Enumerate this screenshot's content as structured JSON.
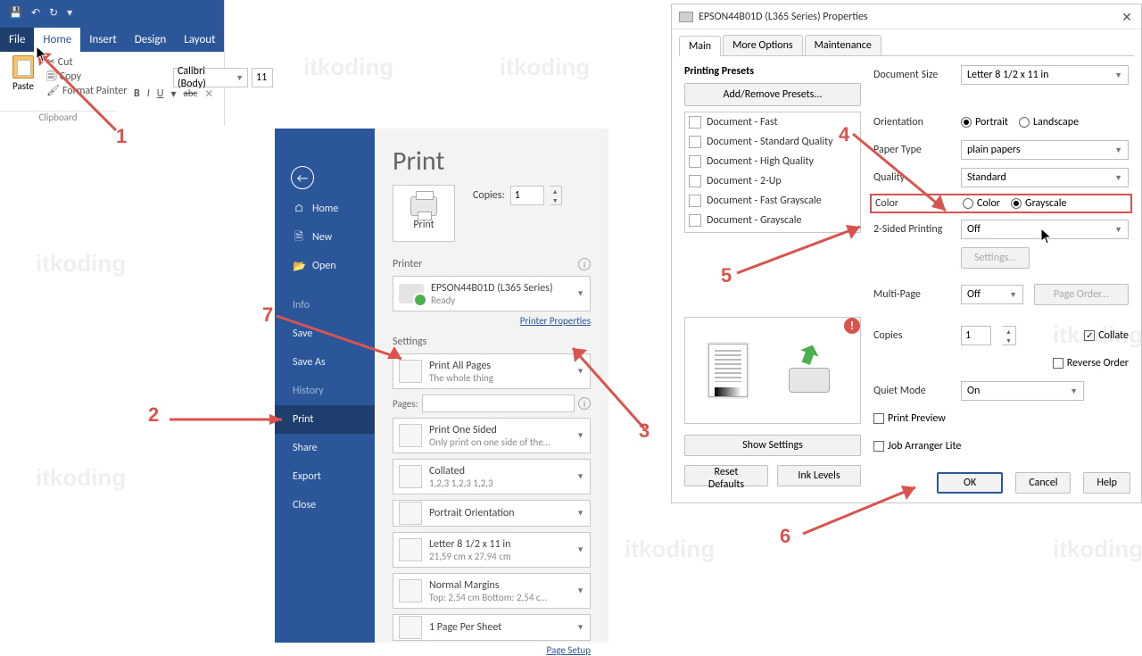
{
  "word": {
    "qat": {
      "save": "💾",
      "undo": "↶",
      "redo": "↻",
      "more": "▾"
    },
    "tabs": [
      "File",
      "Home",
      "Insert",
      "Design",
      "Layout"
    ],
    "paste_label": "Paste",
    "cut": "Cut",
    "copy": "Copy",
    "format_painter": "Format Painter",
    "clipboard_group": "Clipboard",
    "font_name": "Calibri (Body)",
    "font_size": "11",
    "b": "B",
    "i": "I",
    "u": "U",
    "strike": "abc",
    "x": "✕"
  },
  "backstage": {
    "items": [
      {
        "icon": "⌂",
        "label": "Home"
      },
      {
        "icon": "🗎",
        "label": "New"
      },
      {
        "icon": "📂",
        "label": "Open"
      },
      {
        "icon": "",
        "label": "Info",
        "dim": true
      },
      {
        "icon": "",
        "label": "Save"
      },
      {
        "icon": "",
        "label": "Save As"
      },
      {
        "icon": "",
        "label": "History",
        "dim": true
      },
      {
        "icon": "",
        "label": "Print",
        "active": true
      },
      {
        "icon": "",
        "label": "Share"
      },
      {
        "icon": "",
        "label": "Export"
      },
      {
        "icon": "",
        "label": "Close"
      }
    ],
    "title": "Print",
    "print_button": "Print",
    "copies_label": "Copies:",
    "copies_value": "1",
    "printer_header": "Printer",
    "printer_name": "EPSON44B01D (L365 Series)",
    "printer_status": "Ready",
    "printer_properties": "Printer Properties",
    "settings_header": "Settings",
    "pages_label": "Pages:",
    "page_setup": "Page Setup",
    "settings": [
      {
        "t1": "Print All Pages",
        "t2": "The whole thing"
      },
      {
        "t1": "Print One Sided",
        "t2": "Only print on one side of the…"
      },
      {
        "t1": "Collated",
        "t2": "1,2,3    1,2,3    1,2,3"
      },
      {
        "t1": "Portrait Orientation",
        "t2": ""
      },
      {
        "t1": "Letter 8 1/2 x 11 in",
        "t2": "21,59 cm x 27,94 cm"
      },
      {
        "t1": "Normal Margins",
        "t2": "Top: 2,54 cm Bottom: 2,54 c…"
      },
      {
        "t1": "1 Page Per Sheet",
        "t2": ""
      }
    ]
  },
  "dlg": {
    "title": "EPSON44B01D (L365 Series) Properties",
    "tabs": [
      "Main",
      "More Options",
      "Maintenance"
    ],
    "presets_title": "Printing Presets",
    "add_remove": "Add/Remove Presets...",
    "preset_items": [
      "Document - Fast",
      "Document - Standard Quality",
      "Document - High Quality",
      "Document - 2-Up",
      "Document - Fast Grayscale",
      "Document - Grayscale"
    ],
    "show_settings": "Show Settings",
    "reset_defaults": "Reset Defaults",
    "ink_levels": "Ink Levels",
    "labels": {
      "doc_size": "Document Size",
      "orientation": "Orientation",
      "paper_type": "Paper Type",
      "quality": "Quality",
      "color": "Color",
      "two_sided": "2-Sided Printing",
      "multi_page": "Multi-Page",
      "copies": "Copies",
      "quiet": "Quiet Mode"
    },
    "doc_size": "Letter 8 1/2 x 11 in",
    "orientation": {
      "portrait": "Portrait",
      "landscape": "Landscape",
      "value": "Portrait"
    },
    "paper_type": "plain papers",
    "quality": "Standard",
    "color": {
      "color": "Color",
      "grayscale": "Grayscale",
      "value": "Grayscale"
    },
    "two_sided": "Off",
    "settings_btn": "Settings...",
    "multi_page": "Off",
    "page_order": "Page Order...",
    "copies_value": "1",
    "collate": "Collate",
    "reverse": "Reverse Order",
    "quiet": "On",
    "print_preview": "Print Preview",
    "job_arranger": "Job Arranger Lite",
    "ok": "OK",
    "cancel": "Cancel",
    "help": "Help"
  },
  "annotations": {
    "1": "1",
    "2": "2",
    "3": "3",
    "4": "4",
    "5": "5",
    "6": "6",
    "7": "7"
  },
  "watermark": "itkoding"
}
